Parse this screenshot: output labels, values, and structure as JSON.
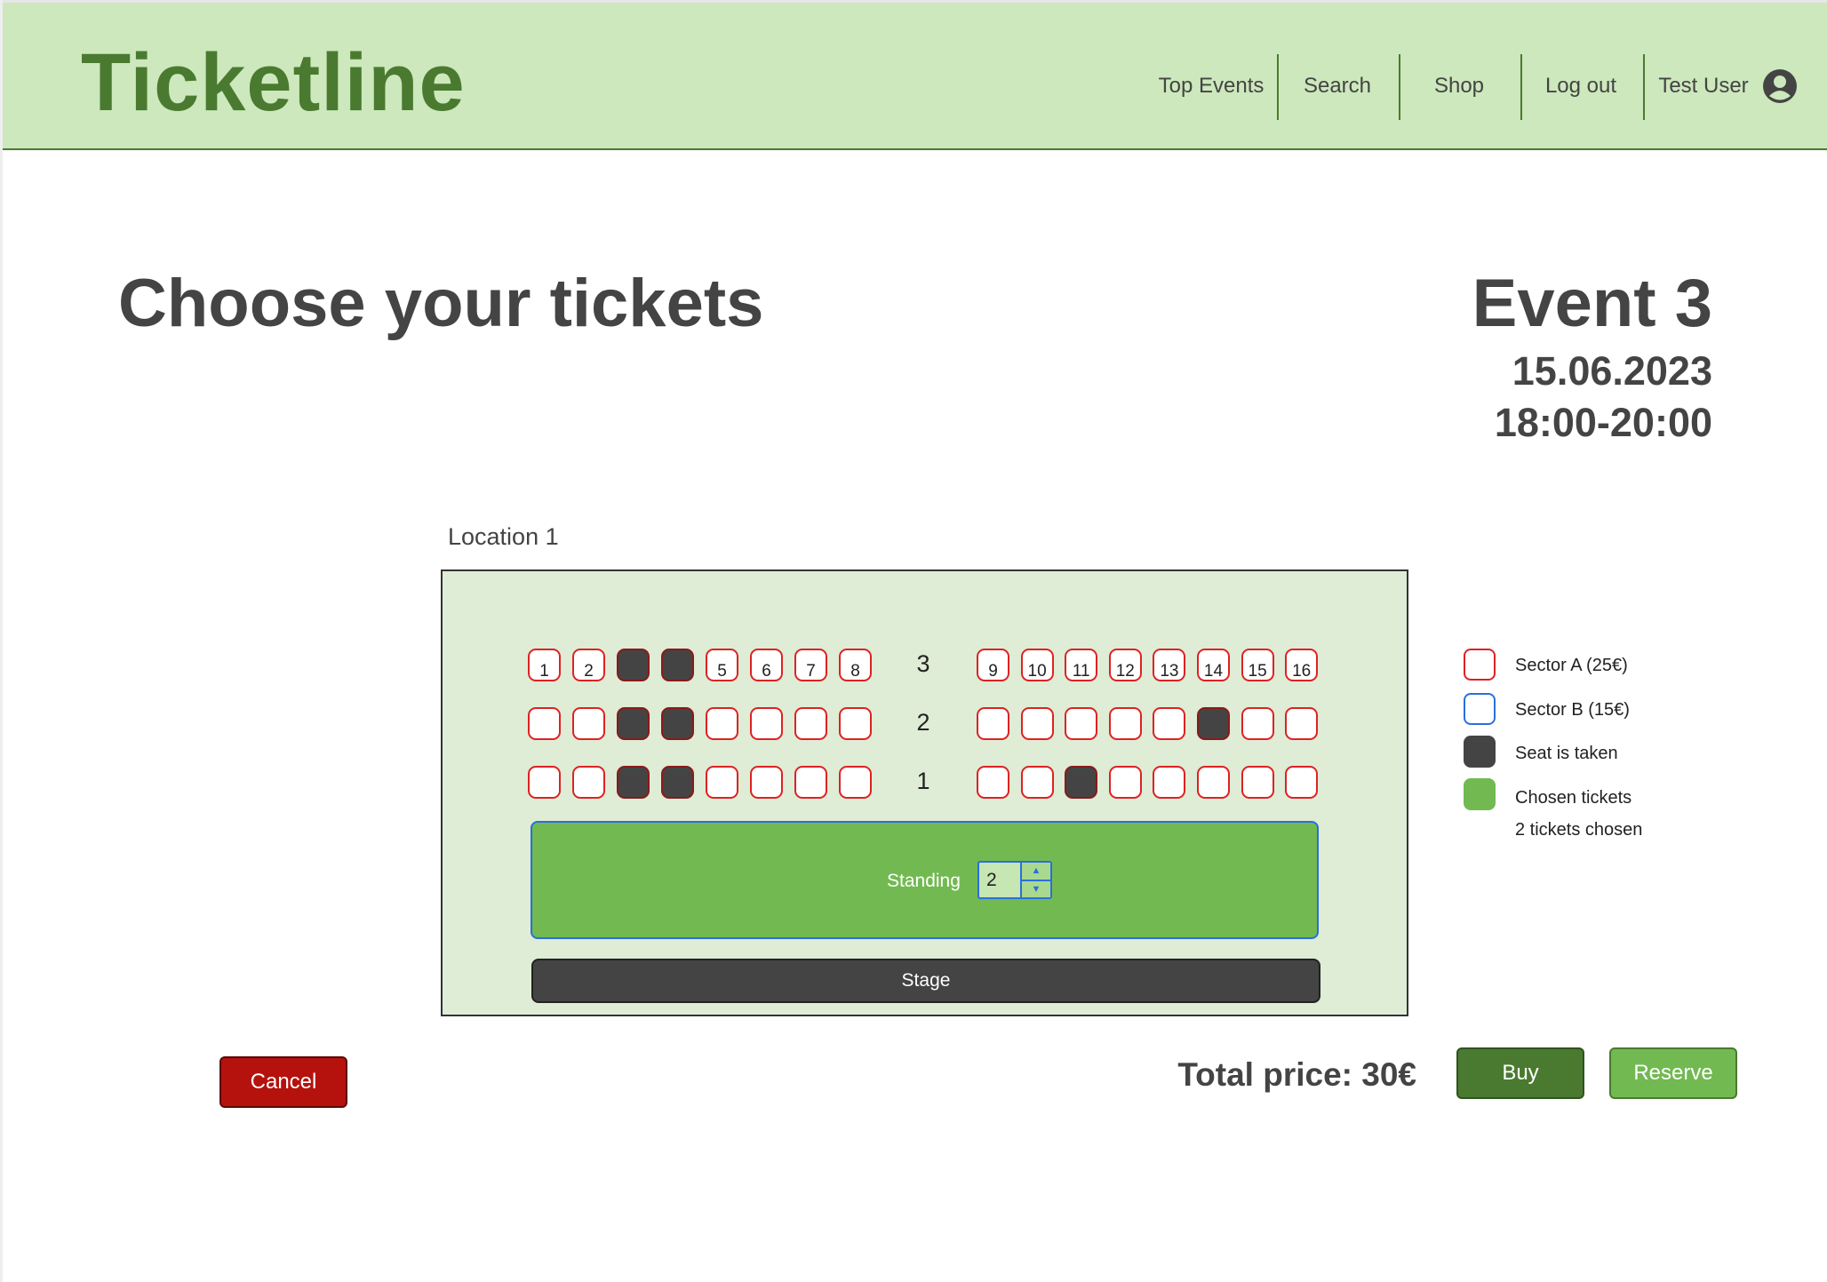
{
  "header": {
    "logo": "Ticketline",
    "nav": [
      "Top Events",
      "Search",
      "Shop",
      "Log out"
    ],
    "user": "Test User"
  },
  "page": {
    "title": "Choose your tickets",
    "event_name": "Event 3",
    "event_date": "15.06.2023",
    "event_time": "18:00-20:00",
    "location": "Location 1"
  },
  "seating": {
    "rows": [
      {
        "label": "3",
        "show_numbers": true,
        "taken": [
          3,
          4
        ]
      },
      {
        "label": "2",
        "show_numbers": false,
        "taken": [
          3,
          4,
          14
        ]
      },
      {
        "label": "1",
        "show_numbers": false,
        "taken": [
          3,
          4,
          11
        ]
      }
    ],
    "seats_per_row": 16,
    "standing_label": "Standing",
    "standing_count": "2",
    "stage_label": "Stage"
  },
  "legend": {
    "items": [
      {
        "label": "Sector A (25€)",
        "color": "#dd2222",
        "type": "outline"
      },
      {
        "label": "Sector B (15€)",
        "color": "#2a6fdc",
        "type": "outline"
      },
      {
        "label": "Seat is taken",
        "color": "#444444",
        "type": "fill"
      },
      {
        "label": "Chosen tickets",
        "color": "#72b952",
        "type": "fill"
      }
    ],
    "chosen_summary": "2 tickets chosen"
  },
  "footer": {
    "cancel": "Cancel",
    "total": "Total price: 30€",
    "buy": "Buy",
    "reserve": "Reserve"
  }
}
